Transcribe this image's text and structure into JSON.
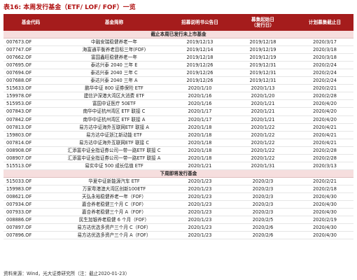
{
  "title": {
    "label": "表16:",
    "text": "本周发行基金（ETF/ LOF/ FOF）一览"
  },
  "columns": [
    "基金代码",
    "基金简称",
    "招募说明书公告日",
    "募集起始日\n（发行日）",
    "计划募集截止日"
  ],
  "section1": "截止本周已发行未上市基金",
  "rows1": [
    [
      "007673.OF",
      "中融安瑞稳健养老一年",
      "2019/12/13",
      "2019/12/18",
      "2020/3/17"
    ],
    [
      "007747.OF",
      "海富通平衡养老目标三年(FOF)",
      "2019/12/14",
      "2019/12/19",
      "2020/3/18"
    ],
    [
      "007662.OF",
      "富国鑫旺稳健养老一年",
      "2019/12/18",
      "2019/12/19",
      "2020/3/18"
    ],
    [
      "007695.OF",
      "泰达兴泰 2040 三年 E",
      "2019/12/26",
      "2019/12/31",
      "2020/2/24"
    ],
    [
      "007694.OF",
      "泰达兴泰 2040 三年 C",
      "2019/12/26",
      "2019/12/31",
      "2020/2/24"
    ],
    [
      "007688.OF",
      "泰达兴泰 2040 三年 A",
      "2019/12/26",
      "2019/12/31",
      "2020/2/24"
    ],
    [
      "515633.OF",
      "鹏华中证 800 证券保险 ETF",
      "2020/1/10",
      "2020/1/13",
      "2020/2/21"
    ],
    [
      "159978.OF",
      "建信沪深港大湾区大消费 ETF",
      "2020/1/16",
      "2020/1/20",
      "2020/2/28"
    ],
    [
      "515953.OF",
      "富国中证医疗 50ETF",
      "2020/1/16",
      "2020/1/21",
      "2020/4/20"
    ],
    [
      "007843.OF",
      "南华中证杭州湾区 ETF 联接 C",
      "2020/1/17",
      "2020/1/21",
      "2020/4/20"
    ],
    [
      "007842.OF",
      "南华中证杭州湾区 ETF 联接 A",
      "2020/1/17",
      "2020/1/21",
      "2020/4/20"
    ],
    [
      "007813.OF",
      "易方达中证海外互联网ETF 联接 A",
      "2020/1/18",
      "2020/1/22",
      "2020/4/21"
    ],
    [
      "159803.OF",
      "易方达中证浙江新动能 ETF",
      "2020/1/18",
      "2020/1/22",
      "2020/4/21"
    ],
    [
      "007814.OF",
      "易方达中证海外互联网ETF 联接 C",
      "2020/1/18",
      "2020/1/22",
      "2020/4/21"
    ],
    [
      "008908.OF",
      "汇添富中证全指证券公司一带一路ETF 联接 C",
      "2020/1/18",
      "2020/1/22",
      "2020/2/28"
    ],
    [
      "008907.OF",
      "汇添富中证全指证券公司一带一路ETF 联接 A",
      "2020/1/18",
      "2020/1/22",
      "2020/2/28"
    ],
    [
      "515513.OF",
      "易实中证 500 成长估值 ETF",
      "2020/1/21",
      "2020/1/31",
      "2020/3/13"
    ]
  ],
  "section2": "下周即将发行基金",
  "rows2": [
    [
      "515033.OF",
      "华夏中证新能源汽车 ETF",
      "2020/1/23",
      "2020/2/3",
      "2020/2/21"
    ],
    [
      "159983.OF",
      "万家粤港澳大湾区创新100ETF",
      "2020/1/23",
      "2020/2/3",
      "2020/2/18"
    ],
    [
      "008621.OF",
      "天弘永裕稳健养老一年（FOF）",
      "2020/1/23",
      "2020/2/3",
      "2020/4/30"
    ],
    [
      "007934.OF",
      "嘉合养老稳健三个月 C（FOF）",
      "2020/1/23",
      "2020/2/3",
      "2020/4/30"
    ],
    [
      "007933.OF",
      "嘉合养老稳健三个月 A（FOF）",
      "2020/1/23",
      "2020/2/3",
      "2020/4/30"
    ],
    [
      "008886.OF",
      "民生加银养老稳健 6 个月（FOF）",
      "2020/1/23",
      "2020/2/5",
      "2020/2/19"
    ],
    [
      "007897.OF",
      "易方达优选多资产三个月 C（FOF）",
      "2020/1/23",
      "2020/2/6",
      "2020/4/30"
    ],
    [
      "007896.OF",
      "易方达优选多资产三个月 A（FOF）",
      "2020/1/23",
      "2020/2/6",
      "2020/4/30"
    ]
  ],
  "source": "资料来源：Wind，光大证券研究所（注：截止2020-01-23）"
}
